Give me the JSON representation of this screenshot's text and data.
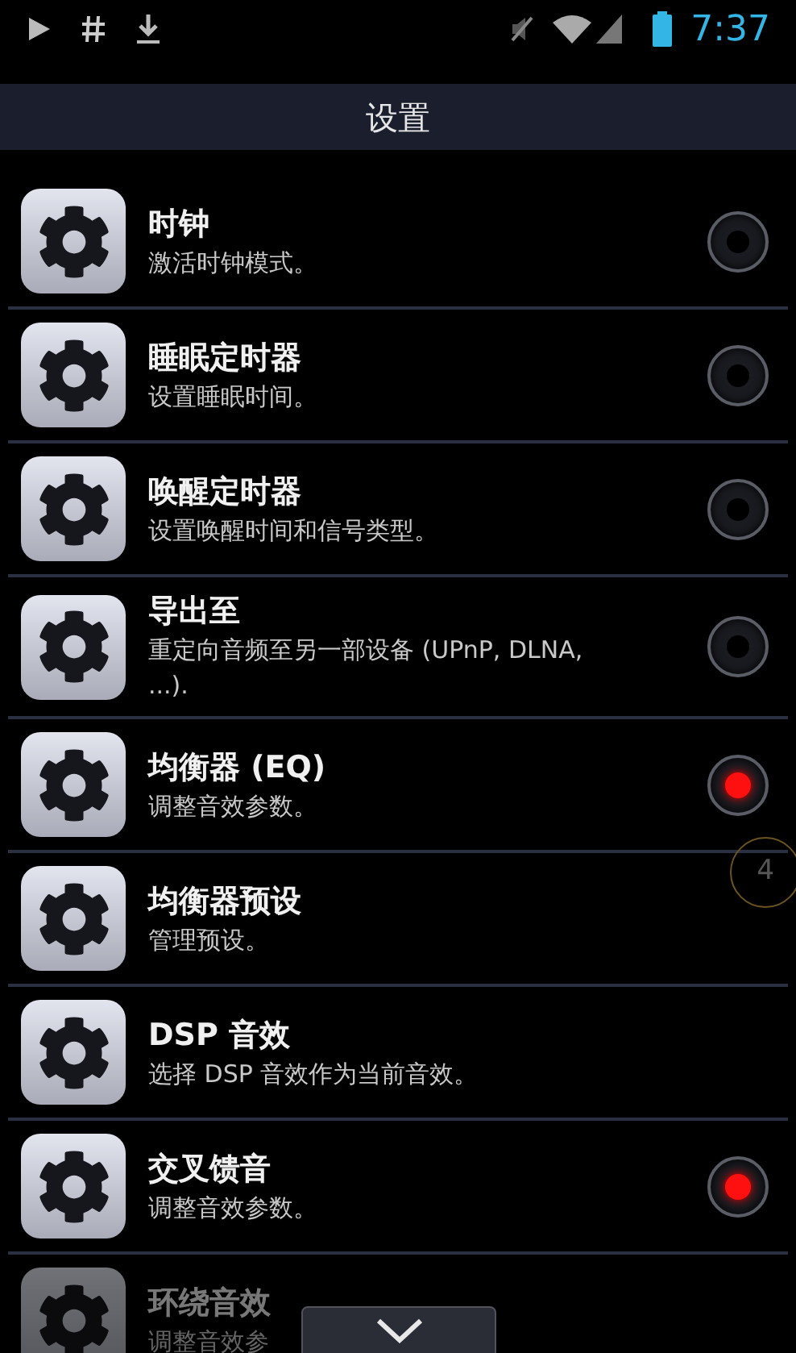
{
  "status_bar": {
    "time": "7:37"
  },
  "header": {
    "title": "设置"
  },
  "items": [
    {
      "title": "时钟",
      "subtitle": "激活时钟模式。",
      "on": false,
      "dimmed": false
    },
    {
      "title": "睡眠定时器",
      "subtitle": "设置睡眠时间。",
      "on": false,
      "dimmed": false
    },
    {
      "title": "唤醒定时器",
      "subtitle": "设置唤醒时间和信号类型。",
      "on": false,
      "dimmed": false
    },
    {
      "title": "导出至",
      "subtitle": "重定向音频至另一部设备 (UPnP, DLNA, ...).",
      "on": false,
      "dimmed": false
    },
    {
      "title": "均衡器 (EQ)",
      "subtitle": "调整音效参数。",
      "on": true,
      "dimmed": false
    },
    {
      "title": "均衡器预设",
      "subtitle": "管理预设。",
      "dimmed": false
    },
    {
      "title": "DSP 音效",
      "subtitle": "选择 DSP 音效作为当前音效。",
      "dimmed": false
    },
    {
      "title": "交叉馈音",
      "subtitle": "调整音效参数。",
      "on": true,
      "dimmed": false
    },
    {
      "title": "环绕音效",
      "subtitle": "调整音效参",
      "dimmed": true
    }
  ],
  "page_badge": "4"
}
